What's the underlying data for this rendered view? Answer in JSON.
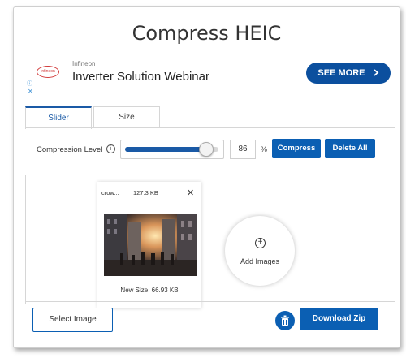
{
  "page": {
    "title": "Compress HEIC"
  },
  "ad": {
    "logo_text": "infineon",
    "brand": "Infineon",
    "headline": "Inverter Solution Webinar",
    "cta": "SEE MORE",
    "cta_icon": "chevron-right-icon",
    "info_glyph": "ⓘ",
    "close_glyph": "✕"
  },
  "tabs": [
    {
      "label": "Slider",
      "active": true
    },
    {
      "label": "Size",
      "active": false
    }
  ],
  "compression": {
    "label": "Compression Level",
    "info_glyph": "i",
    "value": "86",
    "unit": "%",
    "slider_value_fraction": 0.86,
    "compress_label": "Compress",
    "delete_all_label": "Delete All"
  },
  "files": [
    {
      "name": "crow...",
      "size": "127.3 KB",
      "new_size": "New Size: 66.93 KB",
      "close_glyph": "✕"
    }
  ],
  "add_images": {
    "label": "Add Images",
    "icon": "plus-circle-icon"
  },
  "footer": {
    "select_label": "Select Image",
    "download_label": "Download Zip",
    "trash_icon": "trash-icon"
  },
  "colors": {
    "accent": "#0b5fb3",
    "ad_button": "#0b4f9e"
  }
}
